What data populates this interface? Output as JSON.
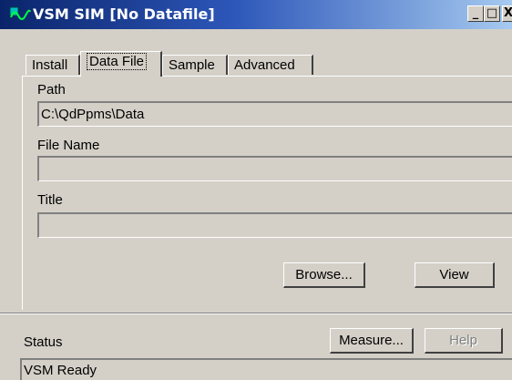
{
  "window": {
    "title": "VSM SIM [No Datafile]",
    "controls": {
      "minimize": "_",
      "maximize": "□",
      "close": "X"
    }
  },
  "tabs": [
    {
      "label": "Install",
      "active": false
    },
    {
      "label": "Data File",
      "active": true
    },
    {
      "label": "Sample",
      "active": false
    },
    {
      "label": "Advanced",
      "active": false
    }
  ],
  "data_file": {
    "path_label": "Path",
    "path_value": "C:\\QdPpms\\Data",
    "file_name_label": "File Name",
    "file_name_value": "",
    "title_label": "Title",
    "title_value": "",
    "browse_label": "Browse...",
    "view_label": "View"
  },
  "footer": {
    "status_label": "Status",
    "measure_label": "Measure...",
    "help_label": "Help",
    "help_enabled": false,
    "status_text": "VSM Ready"
  },
  "colors": {
    "face": "#d4d0c8",
    "titlebar_start": "#0a246a",
    "titlebar_end": "#a6caf0"
  }
}
